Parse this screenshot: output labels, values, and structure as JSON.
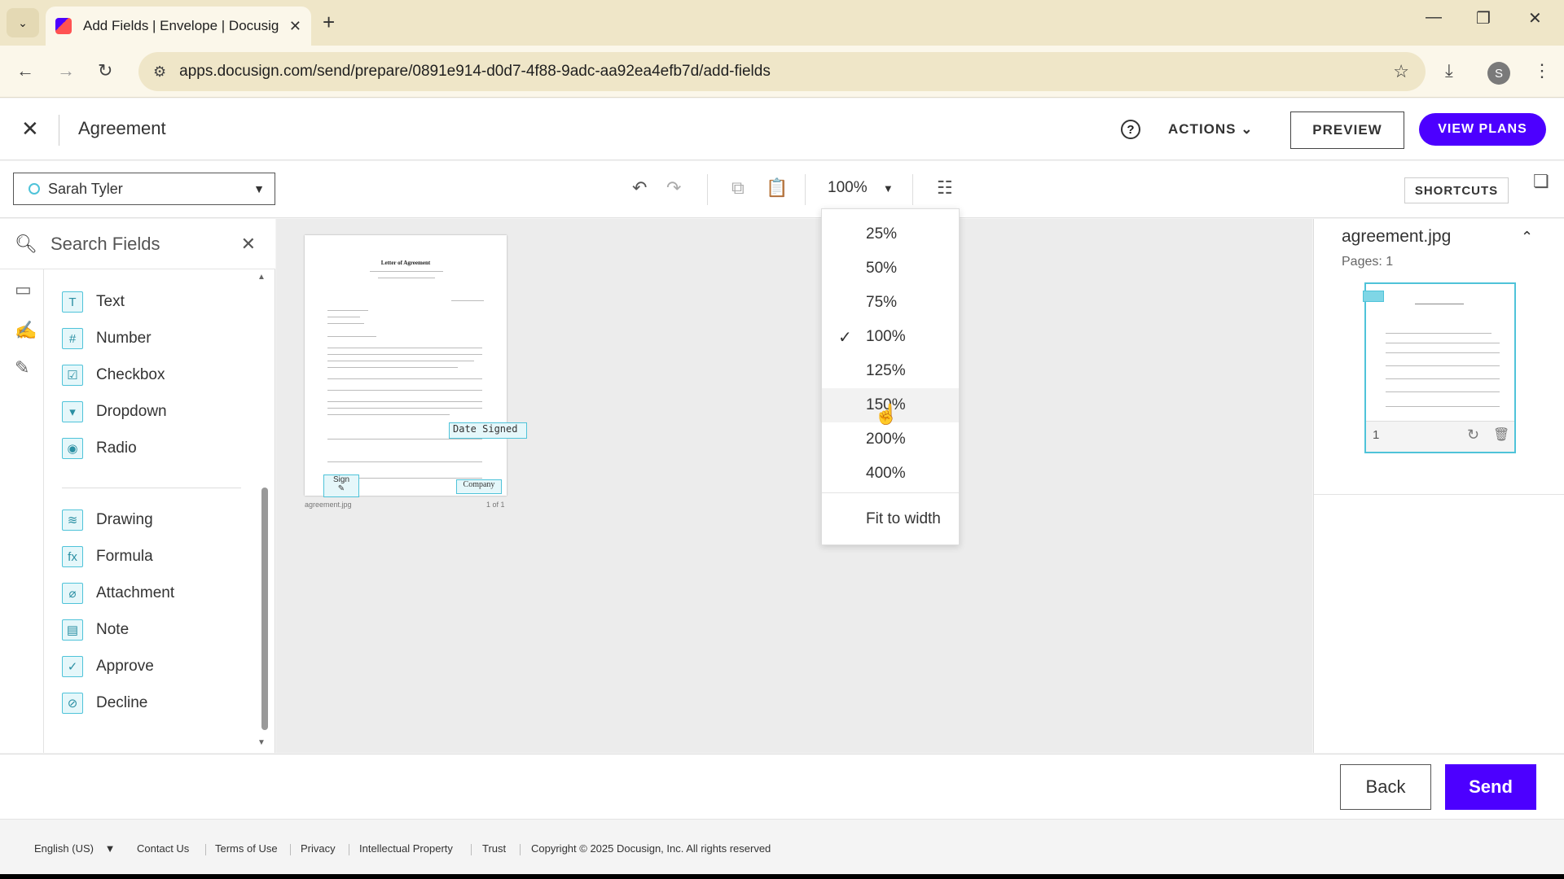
{
  "browser": {
    "tab_title": "Add Fields | Envelope | Docusig",
    "url": "apps.docusign.com/send/prepare/0891e914-d0d7-4f88-9adc-aa92ea4efb7d/add-fields",
    "profile_initial": "S"
  },
  "header": {
    "title": "Agreement",
    "actions_label": "ACTIONS",
    "preview_label": "PREVIEW",
    "view_plans_label": "VIEW PLANS"
  },
  "toolbar": {
    "recipient": "Sarah Tyler",
    "zoom_value": "100%",
    "shortcuts_label": "SHORTCUTS"
  },
  "left_panel": {
    "search_placeholder": "Search Fields",
    "fields_group1": [
      {
        "label": "Text",
        "icon": "T"
      },
      {
        "label": "Number",
        "icon": "#"
      },
      {
        "label": "Checkbox",
        "icon": "☑"
      },
      {
        "label": "Dropdown",
        "icon": "▾"
      },
      {
        "label": "Radio",
        "icon": "◉"
      }
    ],
    "fields_group2": [
      {
        "label": "Drawing",
        "icon": "≋"
      },
      {
        "label": "Formula",
        "icon": "fx"
      },
      {
        "label": "Attachment",
        "icon": "⌀"
      },
      {
        "label": "Note",
        "icon": "▤"
      },
      {
        "label": "Approve",
        "icon": "✓"
      },
      {
        "label": "Decline",
        "icon": "⊘"
      }
    ]
  },
  "document": {
    "page_title": "Letter of Agreement",
    "tag_date_signed": "Date Signed",
    "tag_sign": "Sign",
    "tag_company": "Company",
    "file_caption": "agreement.jpg",
    "page_caption": "1 of 1"
  },
  "zoom_menu": {
    "options": [
      "25%",
      "50%",
      "75%",
      "100%",
      "125%",
      "150%",
      "200%",
      "400%"
    ],
    "selected": "100%",
    "hovered": "150%",
    "fit_label": "Fit to width"
  },
  "right_panel": {
    "filename": "agreement.jpg",
    "pages": "Pages: 1",
    "page_number": "1"
  },
  "bottom": {
    "back_label": "Back",
    "send_label": "Send"
  },
  "footer": {
    "language": "English (US)",
    "links": [
      "Contact Us",
      "Terms of Use",
      "Privacy",
      "Intellectual Property",
      "Trust"
    ],
    "copyright": "Copyright © 2025 Docusign, Inc. All rights reserved"
  },
  "colors": {
    "brand": "#4c00ff",
    "field_accent": "#4fc3d9"
  }
}
